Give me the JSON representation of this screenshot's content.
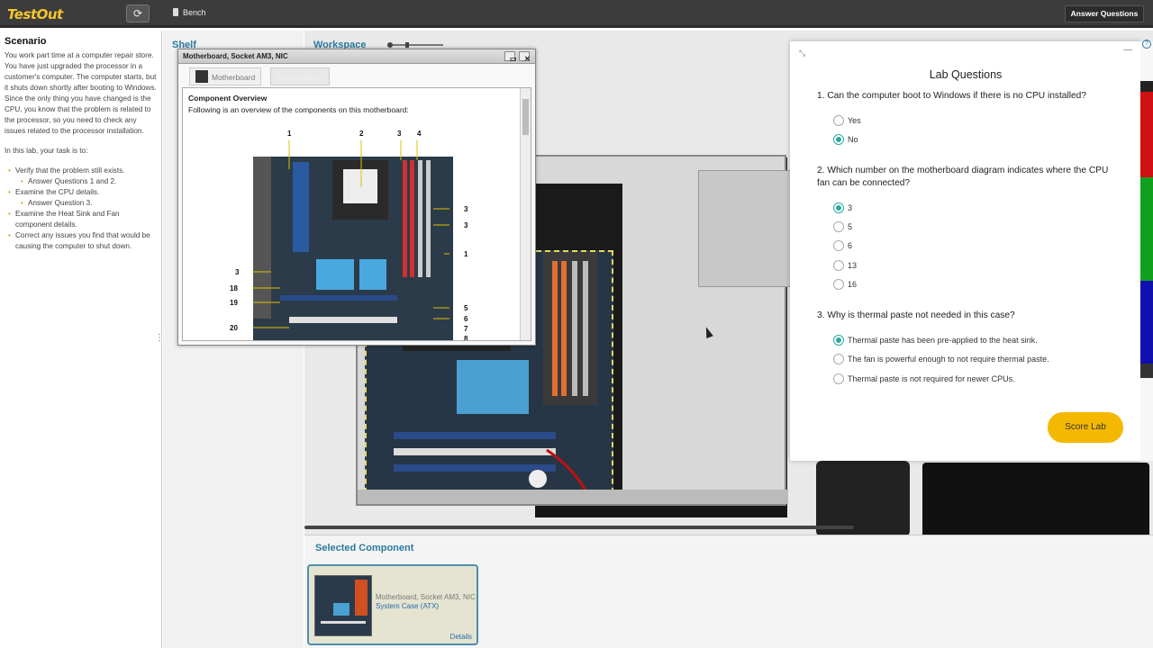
{
  "topbar": {
    "logo": "TestOut",
    "bench_label": "Bench",
    "answer_button": "Answer Questions"
  },
  "scenario": {
    "title": "Scenario",
    "intro": "You work part time at a computer repair store. You have just upgraded the processor in a customer's computer. The computer starts, but it shuts down shortly after booting to Windows. Since the only thing you have changed is the CPU, you know that the problem is related to the processor, so you need to check any issues related to the processor installation.",
    "task_intro": "In this lab, your task is to:",
    "tasks": [
      {
        "text": "Verify that the problem still exists.",
        "level": 1
      },
      {
        "text": "Answer Questions 1 and 2.",
        "level": 2
      },
      {
        "text": "Examine the CPU details.",
        "level": 1
      },
      {
        "text": "Answer Question 3.",
        "level": 2
      },
      {
        "text": "Examine the Heat Sink and Fan component details.",
        "level": 1
      },
      {
        "text": "Correct any issues you find that would be causing the computer to shut down.",
        "level": 1
      }
    ]
  },
  "shelf": {
    "title": "Shelf"
  },
  "workspace": {
    "title": "Workspace"
  },
  "popup": {
    "title": "Motherboard, Socket AM3, NIC",
    "tab_motherboard": "Motherboard",
    "tab_specifications": "Specifications",
    "heading": "Component Overview",
    "text": "Following is an overview of the components on this motherboard:",
    "labels": [
      "1",
      "2",
      "3",
      "4",
      "3",
      "3",
      "1",
      "3",
      "18",
      "19",
      "5",
      "6",
      "7",
      "8",
      "20"
    ]
  },
  "selected": {
    "title": "Selected Component",
    "name": "Motherboard, Socket AM3, NIC",
    "sub": "System Case (ATX)",
    "details": "Details"
  },
  "lab": {
    "title": "Lab Questions",
    "score_button": "Score Lab",
    "questions": [
      {
        "text": "1. Can the computer boot to Windows if there is no CPU installed?",
        "options": [
          "Yes",
          "No"
        ],
        "selected": 1
      },
      {
        "text": "2. Which number on the motherboard diagram indicates where the CPU fan can be connected?",
        "options": [
          "3",
          "5",
          "6",
          "13",
          "16"
        ],
        "selected": 0
      },
      {
        "text": "3. Why is thermal paste not needed in this case?",
        "options": [
          "Thermal paste has been pre-applied to the heat sink.",
          "The fan is powerful enough to not require thermal paste.",
          "Thermal paste is not required for newer CPUs."
        ],
        "selected": 0
      }
    ]
  },
  "colors": {
    "accent": "#2a7aa0",
    "radio_selected": "#2aa8a0",
    "score_button": "#f4b800",
    "logo": "#f4c430"
  }
}
